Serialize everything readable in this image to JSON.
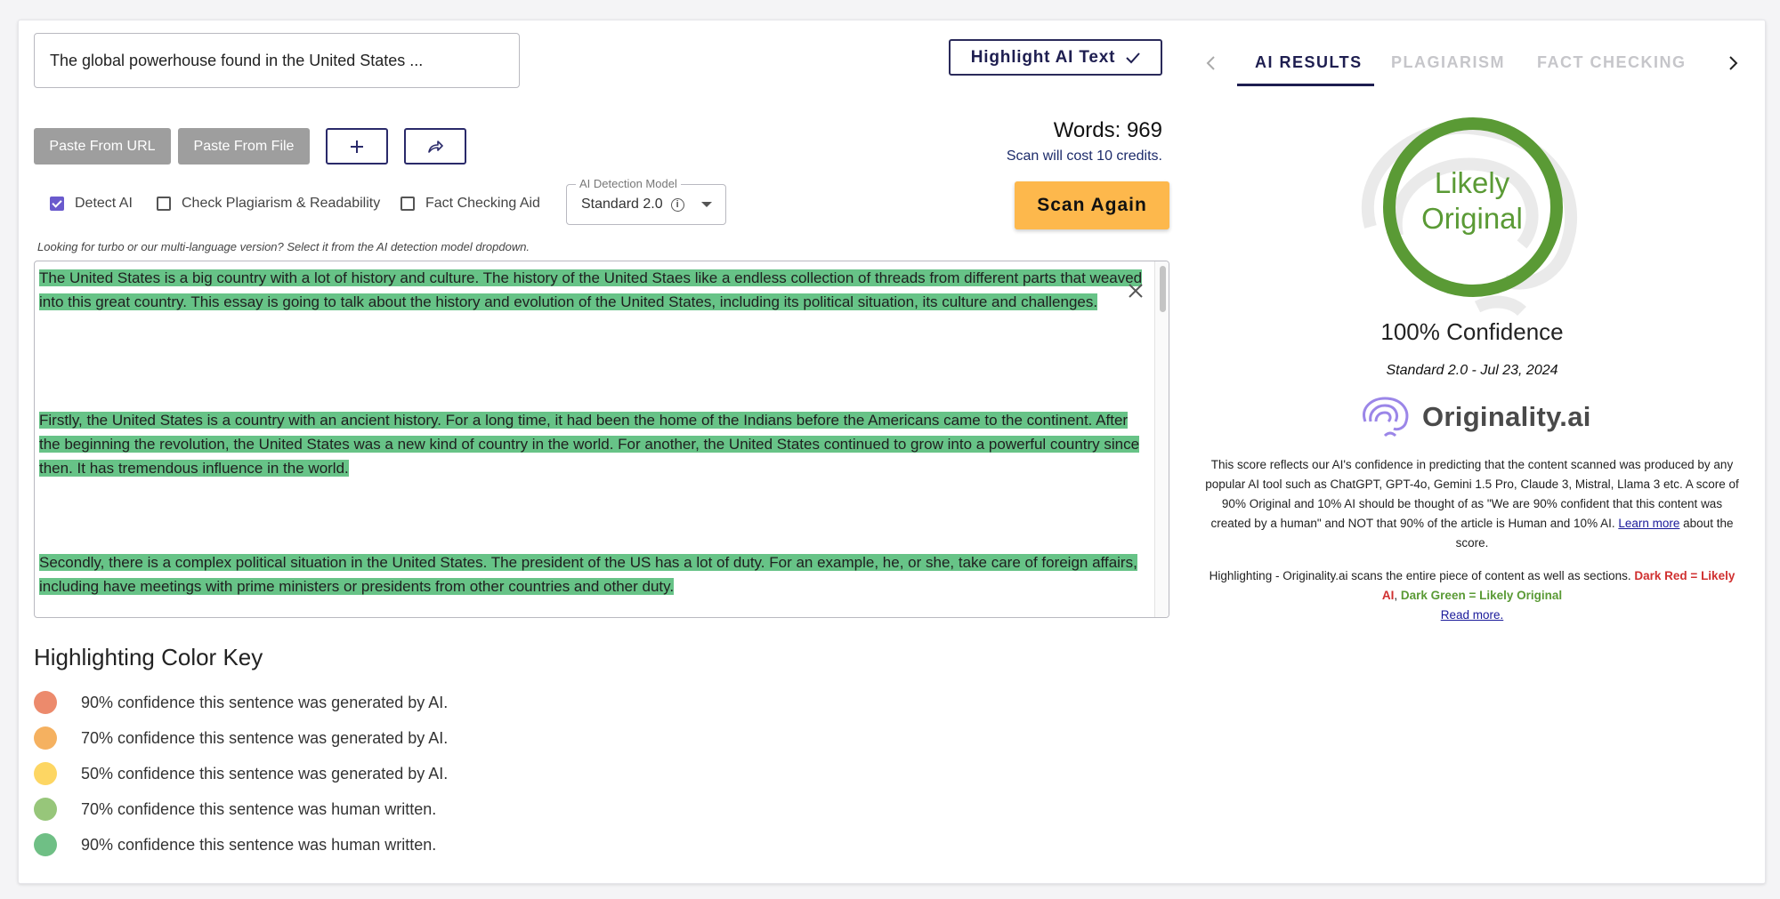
{
  "editor": {
    "title_value": "The global powerhouse found in the United States ...",
    "highlight_button": "Highlight AI Text",
    "paste_url": "Paste From URL",
    "paste_file": "Paste From File",
    "words": "Words: 969",
    "cost": "Scan will cost 10 credits.",
    "options": {
      "detect_ai": "Detect AI",
      "plagiarism": "Check Plagiarism & Readability",
      "fact_check": "Fact Checking Aid"
    },
    "model": {
      "legend": "AI Detection Model",
      "value": "Standard 2.0"
    },
    "scan_button": "Scan Again",
    "hint": "Looking for turbo or our multi-language version? Select it from the AI detection model dropdown.",
    "paragraphs": [
      "The United States is a big country with a lot of history and culture. The history of the United Staes like a endless collection of threads from different parts that weaved into this great country. This essay is going to talk about the history and evolution of the United States, including its political situation, its culture and challenges.",
      "Firstly, the United States is a country with an ancient history. For a long time, it had been the home of the Indians before the Americans came to the continent. After the beginning the revolution, the United States was a new kind of country in the world. For another, the United States continued to grow into a powerful country since then. It has tremendous influence in the world.",
      "Secondly, there is a complex political situation in the United States. The president of the US has a lot of duty. For an example, he, or she, take care of foreign affairs, including have meetings with prime ministers or presidents from other countries and other duty."
    ],
    "highlight_color": "#67c387"
  },
  "color_key": {
    "title": "Highlighting Color Key",
    "items": [
      {
        "color": "#ec8a6c",
        "label": "90% confidence this sentence was generated by AI."
      },
      {
        "color": "#f5b160",
        "label": "70% confidence this sentence was generated by AI."
      },
      {
        "color": "#fdd663",
        "label": "50% confidence this sentence was generated by AI."
      },
      {
        "color": "#97c67a",
        "label": "70% confidence this sentence was human written."
      },
      {
        "color": "#6fbf85",
        "label": "90% confidence this sentence was human written."
      }
    ]
  },
  "results": {
    "tabs": [
      "AI RESULTS",
      "PLAGIARISM",
      "FACT CHECKING"
    ],
    "active_tab": "AI RESULTS",
    "verdict_line1": "Likely",
    "verdict_line2": "Original",
    "original_percent": 100,
    "confidence": "100% Confidence",
    "model_date": "Standard 2.0 - Jul 23, 2024",
    "brand": "Originality.ai",
    "description_main": "This score reflects our AI's confidence in predicting that the content scanned was produced by any popular AI tool such as ChatGPT, GPT-4o, Gemini 1.5 Pro, Claude 3, Mistral, Llama 3 etc. A score of 90% Original and 10% AI should be thought of as \"We are 90% confident that this content was created by a human\" and NOT that 90% of the article is Human and 10% AI.",
    "learn_more": "Learn more",
    "about_score": " about the score.",
    "highlight_note_prefix": "Highlighting - Originality.ai scans the entire piece of content as well as sections. ",
    "dark_red": "Dark Red = Likely AI",
    "separator": ", ",
    "dark_green": "Dark Green = Likely Original",
    "read_more": "Read more.",
    "ring_color": "#5a9a35"
  }
}
